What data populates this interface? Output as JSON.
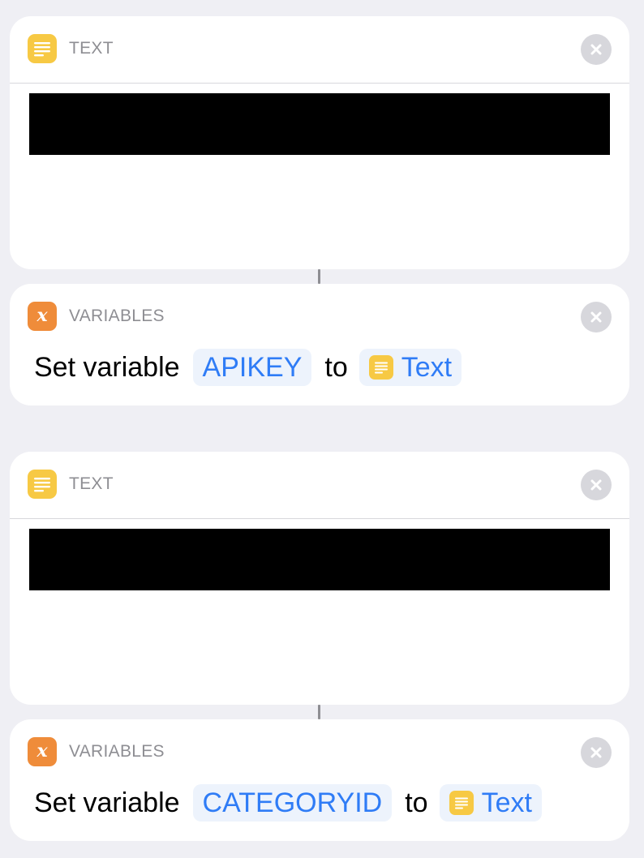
{
  "actions": [
    {
      "type": "text",
      "header": {
        "title": "TEXT",
        "icon": "text-lines-icon"
      }
    },
    {
      "type": "set-variable",
      "header": {
        "title": "VARIABLES",
        "icon": "variable-x-icon",
        "glyph": "x"
      },
      "sentence": {
        "prefix": "Set variable",
        "variable_name": "APIKEY",
        "connector": "to",
        "input_label": "Text"
      }
    },
    {
      "type": "text",
      "header": {
        "title": "TEXT",
        "icon": "text-lines-icon"
      }
    },
    {
      "type": "set-variable",
      "header": {
        "title": "VARIABLES",
        "icon": "variable-x-icon",
        "glyph": "x"
      },
      "sentence": {
        "prefix": "Set variable",
        "variable_name": "CATEGORYID",
        "connector": "to",
        "input_label": "Text"
      }
    }
  ],
  "colors": {
    "background": "#efeff4",
    "text_icon": "#f7c944",
    "variable_icon": "#ef8c3a",
    "token_text": "#2f7cf6",
    "token_background": "#edf3fc",
    "redacted": "#000000"
  }
}
